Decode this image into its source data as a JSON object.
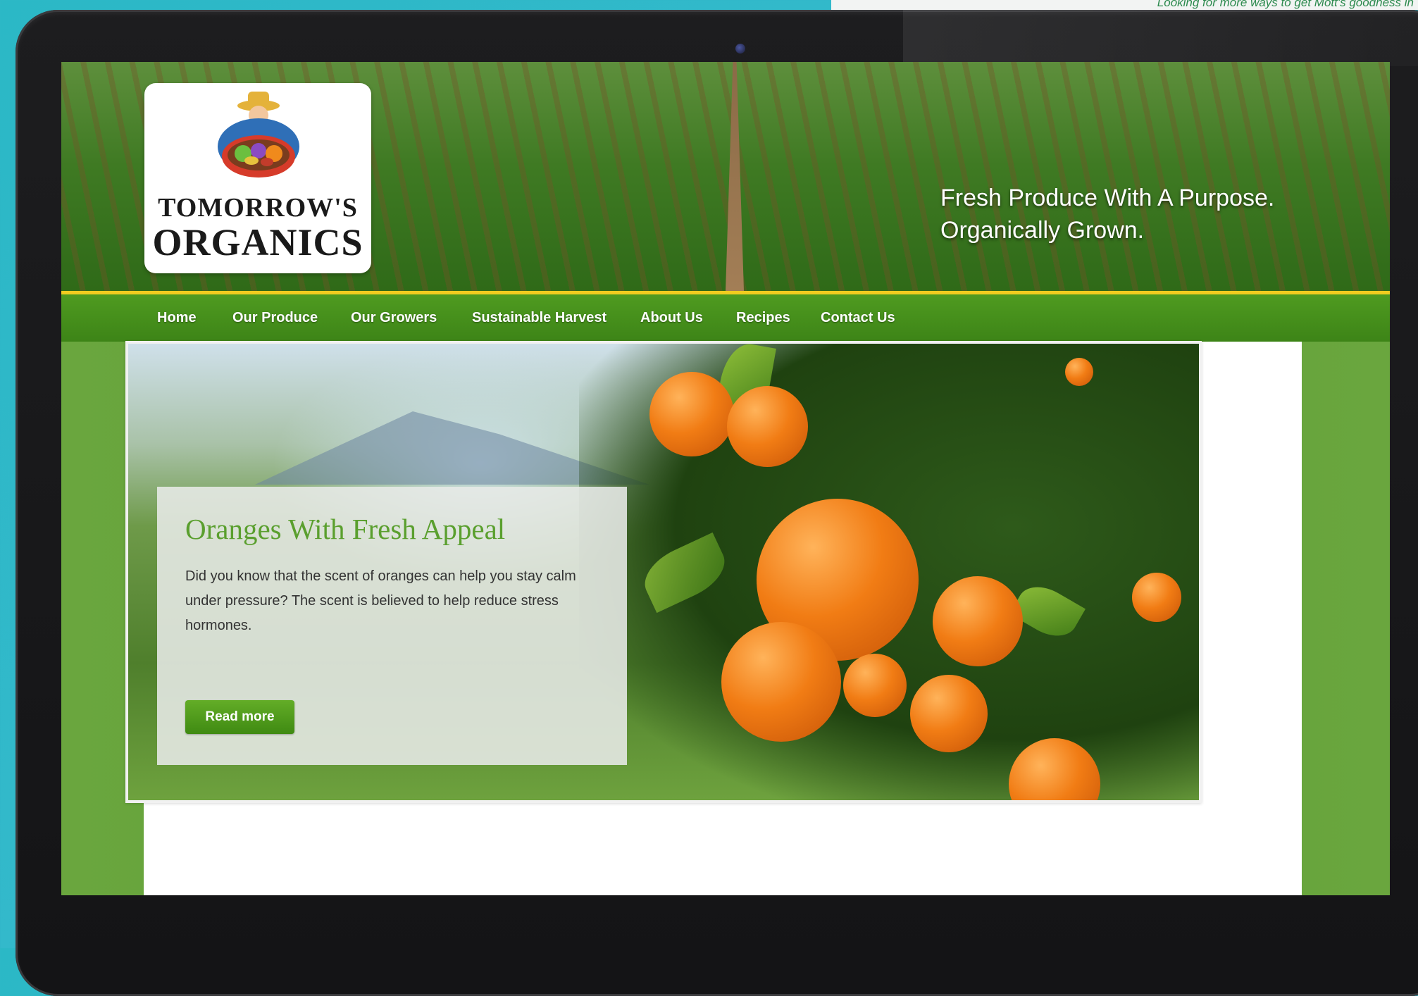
{
  "background_note_text": "Looking for more ways to get Mott's goodness in",
  "site": {
    "logo": {
      "line1": "TOMORROW'S",
      "line2": "ORGANICS"
    },
    "tagline": [
      "Fresh Produce With A Purpose.",
      "Organically Grown."
    ]
  },
  "nav": {
    "items": [
      {
        "label": "Home"
      },
      {
        "label": "Our Produce"
      },
      {
        "label": "Our Growers"
      },
      {
        "label": "Sustainable Harvest"
      },
      {
        "label": "About Us"
      },
      {
        "label": "Recipes"
      },
      {
        "label": "Contact Us"
      }
    ]
  },
  "hero": {
    "title": "Oranges With Fresh Appeal",
    "body": "Did you know that the scent of oranges can help you stay calm under pressure? The scent is believed to help reduce stress hormones.",
    "button_label": "Read more"
  },
  "colors": {
    "brand_green": "#4f9b20",
    "nav_accent_yellow": "#f1cc1f",
    "title_green": "#5a9f2e",
    "laptop_frame": "#1d1d1f",
    "page_background": "#2bb8c6"
  }
}
